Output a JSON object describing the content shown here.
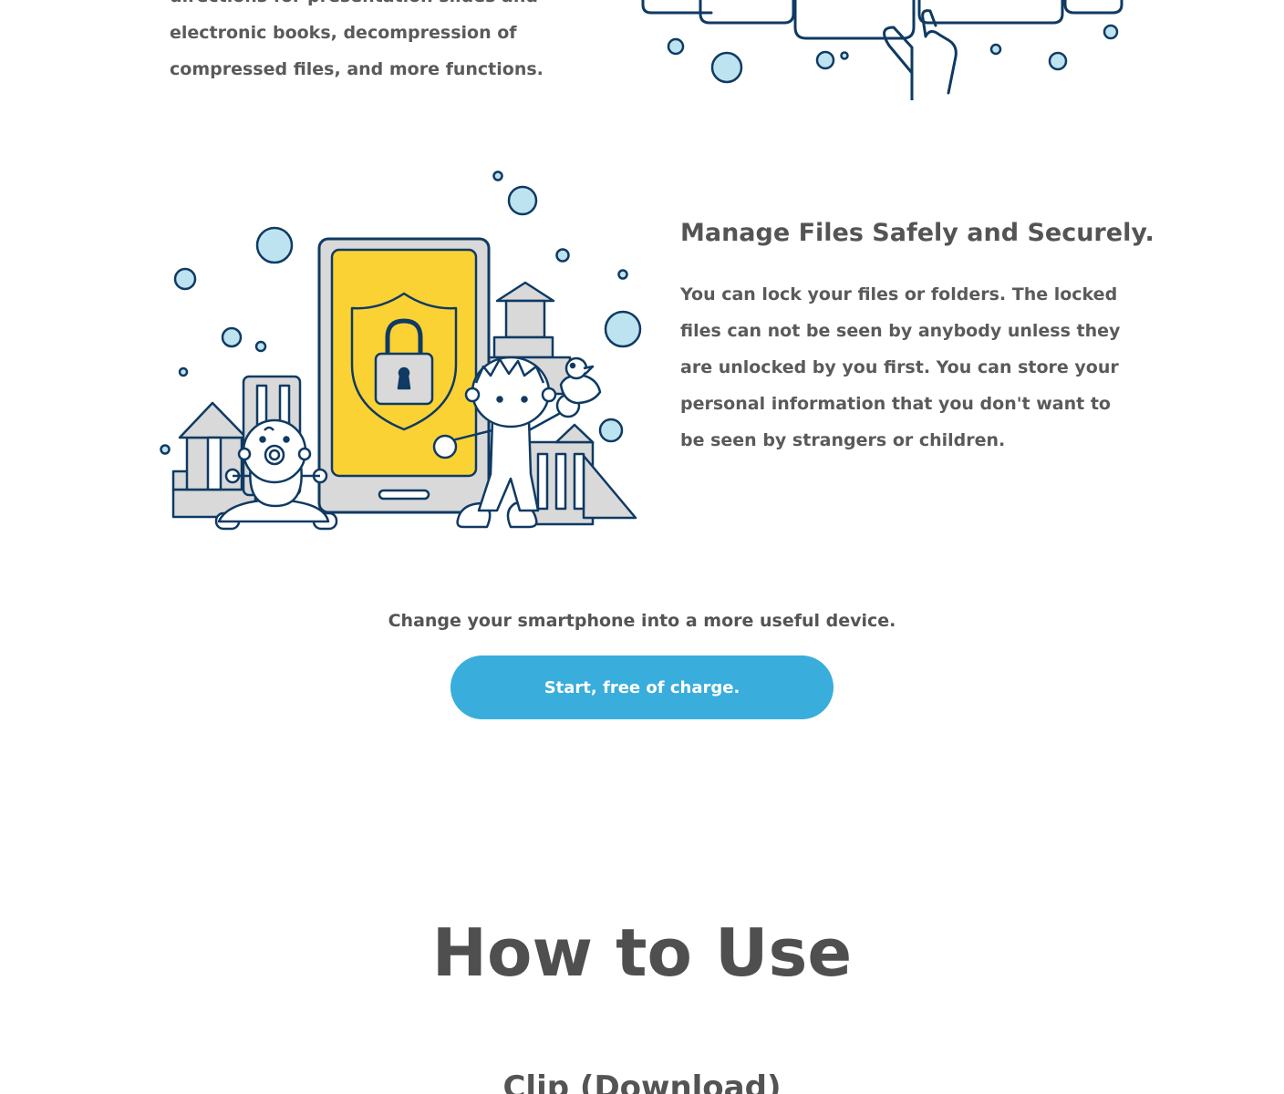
{
  "top_section": {
    "lines": [
      "directions for presentation slides and",
      "electronic books, decompression of",
      "compressed files, and more functions."
    ]
  },
  "security_section": {
    "heading": "Manage Files Safely and Securely.",
    "body_lines": [
      "You can lock your files or folders. The locked",
      "files can not be seen by anybody unless they",
      "are unlocked by you first. You can store your",
      "personal information that you don't want to",
      "be seen by strangers or children."
    ]
  },
  "cta": {
    "text": "Change your smartphone into a more useful device.",
    "button_label": "Start, free of charge."
  },
  "how_to_use": {
    "title": "How to Use",
    "subtitle": "Clip (Download)"
  },
  "colors": {
    "accent": "#39addb",
    "phone_screen": "#fbd234",
    "outline": "#0f3a63",
    "bubble": "#bde3f1",
    "gray_fill": "#d9d9d9",
    "text": "#545454"
  }
}
